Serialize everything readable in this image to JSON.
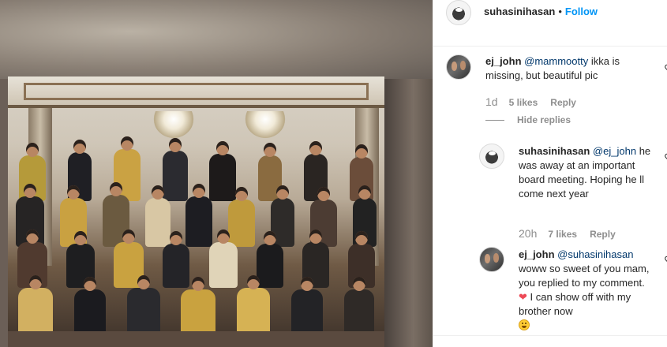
{
  "post": {
    "author": "suhasinihasan",
    "separator": "•",
    "follow_label": "Follow"
  },
  "comments": [
    {
      "username": "ej_john",
      "mention": "@mammootty",
      "text": " ikka is missing, but beautiful pic",
      "time": "1d",
      "likes": "5 likes",
      "reply_label": "Reply",
      "hide_replies_label": "Hide replies"
    }
  ],
  "replies": [
    {
      "username": "suhasinihasan",
      "mention": "@ej_john",
      "text": "he was away at an important board meeting. Hoping he ll come next year",
      "time": "20h",
      "likes": "7 likes",
      "reply_label": "Reply"
    },
    {
      "username": "ej_john",
      "mention": "@suhasinihasan",
      "text_before_heart": "woww so sweet of you mam, you replied to my comment. ",
      "text_after_heart": " I can show off with my brother now"
    }
  ],
  "colors": {
    "link": "#0095f6",
    "mention": "#00376b",
    "muted": "#8e8e8e",
    "heart": "#ed4956"
  },
  "icons": [
    "heart-icon",
    "heart-emoji",
    "grinning-emoji"
  ]
}
